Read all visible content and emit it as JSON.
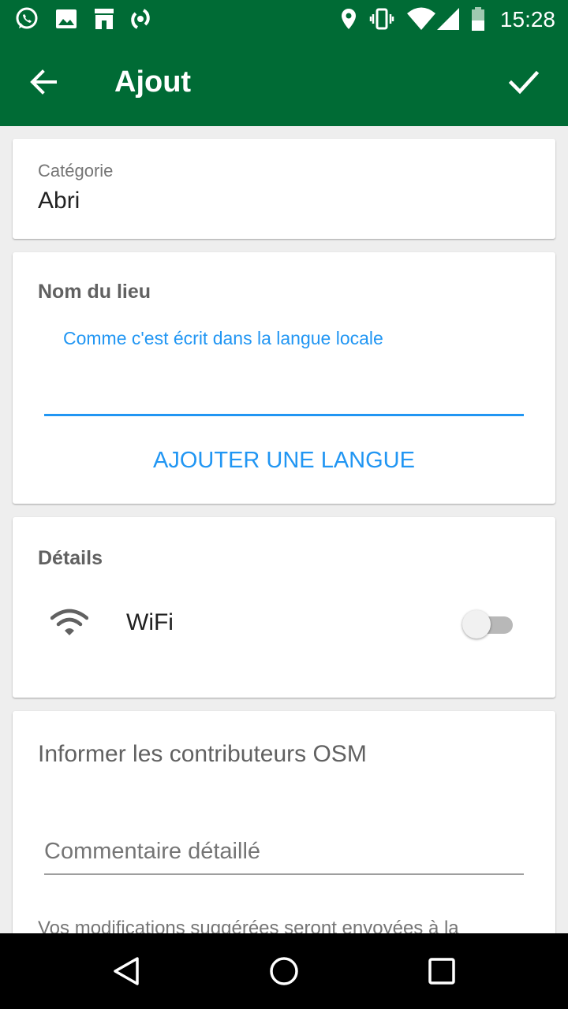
{
  "status_bar": {
    "time": "15:28",
    "left_icons": [
      "whatsapp-icon",
      "image-icon",
      "store-icon",
      "sync-icon"
    ],
    "right_icons": [
      "location-icon",
      "vibrate-icon",
      "wifi-icon",
      "signal-icon",
      "battery-icon"
    ]
  },
  "toolbar": {
    "title": "Ajout",
    "back_icon": "arrow-back-icon",
    "confirm_icon": "check-icon"
  },
  "category": {
    "label": "Catégorie",
    "value": "Abri"
  },
  "place_name": {
    "title": "Nom du lieu",
    "hint": "Comme c'est écrit dans la langue locale",
    "value": "",
    "add_language_label": "AJOUTER UNE LANGUE"
  },
  "details": {
    "title": "Détails",
    "wifi_label": "WiFi",
    "wifi_enabled": false
  },
  "osm": {
    "title": "Informer les contributeurs OSM",
    "comment_placeholder": "Commentaire détaillé",
    "note": "Vos modifications suggérées seront envoyées à la"
  },
  "colors": {
    "primary": "#006b35",
    "accent": "#2196f3",
    "background": "#eeeeee"
  },
  "nav_bar": {
    "icons": [
      "back-triangle-icon",
      "home-circle-icon",
      "recents-square-icon"
    ]
  }
}
